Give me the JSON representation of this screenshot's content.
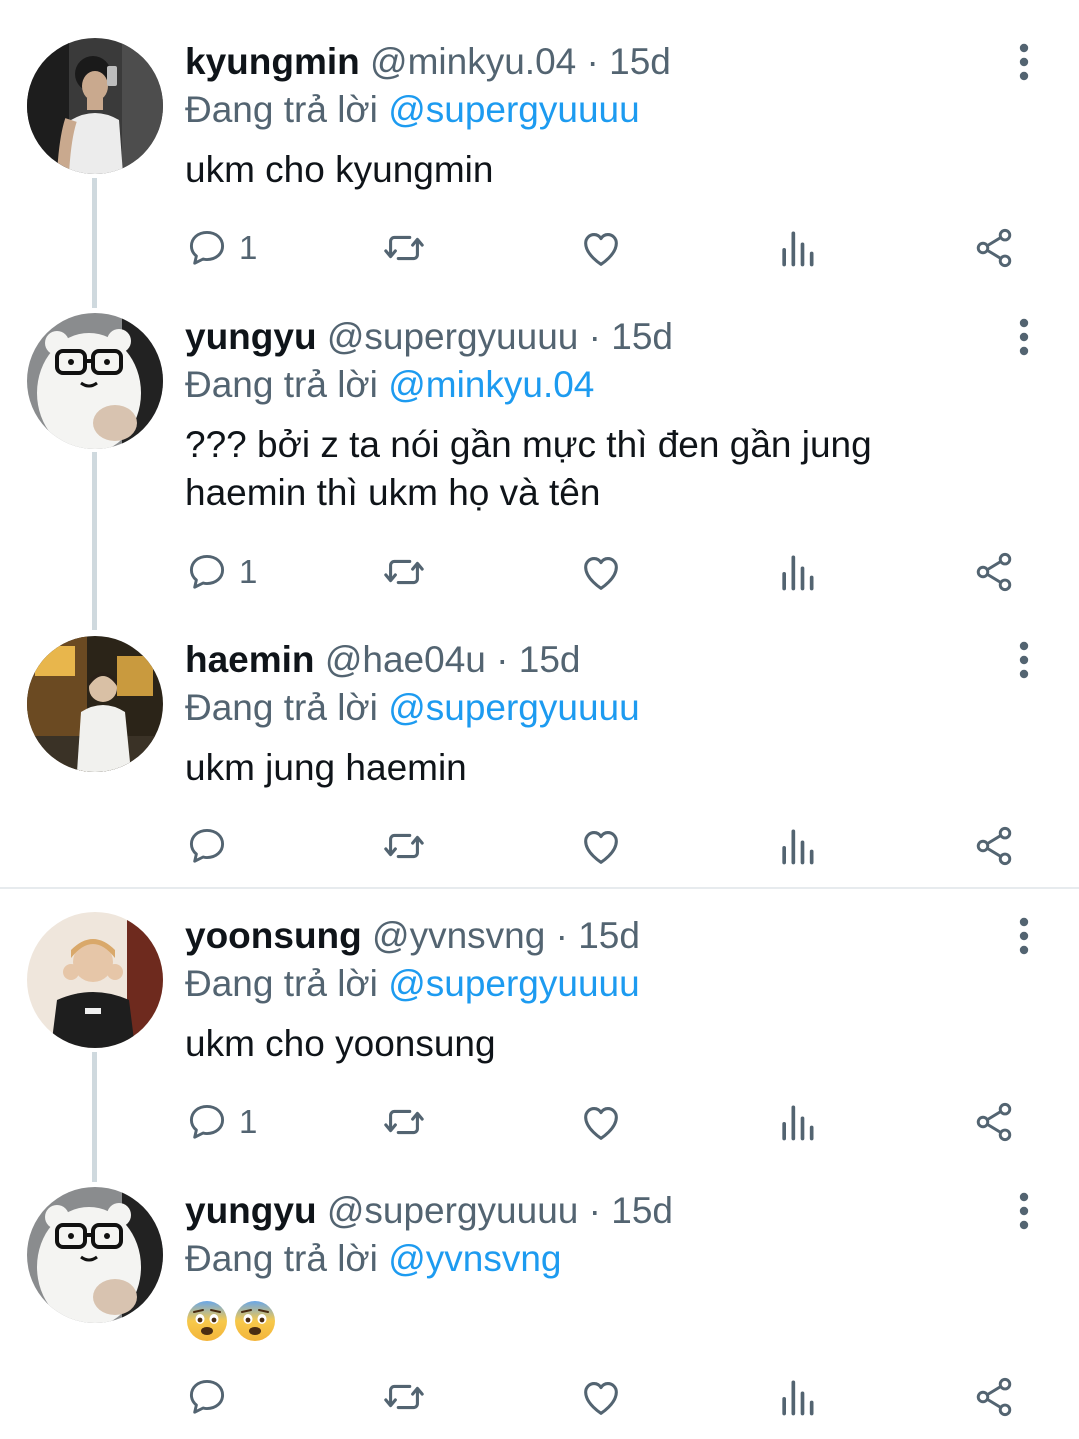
{
  "colors": {
    "text_primary": "#0f1419",
    "text_secondary": "#536471",
    "link": "#1d9bf0",
    "thread_line": "#cfd9de"
  },
  "replying_prefix": "Đang trả lời",
  "tweets": [
    {
      "name": "kyungmin",
      "handle": "@minkyu.04",
      "separator": "·",
      "time": "15d",
      "reply_to": "@supergyuuuu",
      "text_lines": [
        "ukm cho kyungmin"
      ],
      "reply_count": "1",
      "avatar": "mirror-selfie-photo"
    },
    {
      "name": "yungyu",
      "handle": "@supergyuuuu",
      "separator": "·",
      "time": "15d",
      "reply_to": "@minkyu.04",
      "text_lines": [
        "??? bởi z ta nói gần mực thì đen gần jung",
        "haemin thì ukm họ và tên"
      ],
      "reply_count": "1",
      "avatar": "bear-plush-photo"
    },
    {
      "name": "haemin",
      "handle": "@hae04u",
      "separator": "·",
      "time": "15d",
      "reply_to": "@supergyuuuu",
      "text_lines": [
        "ukm jung haemin"
      ],
      "reply_count": "",
      "avatar": "street-night-photo"
    },
    {
      "name": "yoonsung",
      "handle": "@yvnsvng",
      "separator": "·",
      "time": "15d",
      "reply_to": "@supergyuuuu",
      "text_lines": [
        "ukm cho yoonsung"
      ],
      "reply_count": "1",
      "avatar": "portrait-photo"
    },
    {
      "name": "yungyu",
      "handle": "@supergyuuuu",
      "separator": "·",
      "time": "15d",
      "reply_to": "@yvnsvng",
      "emojis": [
        "😨",
        "😨"
      ],
      "reply_count": "",
      "avatar": "bear-plush-photo"
    }
  ],
  "action_icons": [
    "reply-icon",
    "retweet-icon",
    "like-icon",
    "views-icon",
    "share-icon"
  ]
}
